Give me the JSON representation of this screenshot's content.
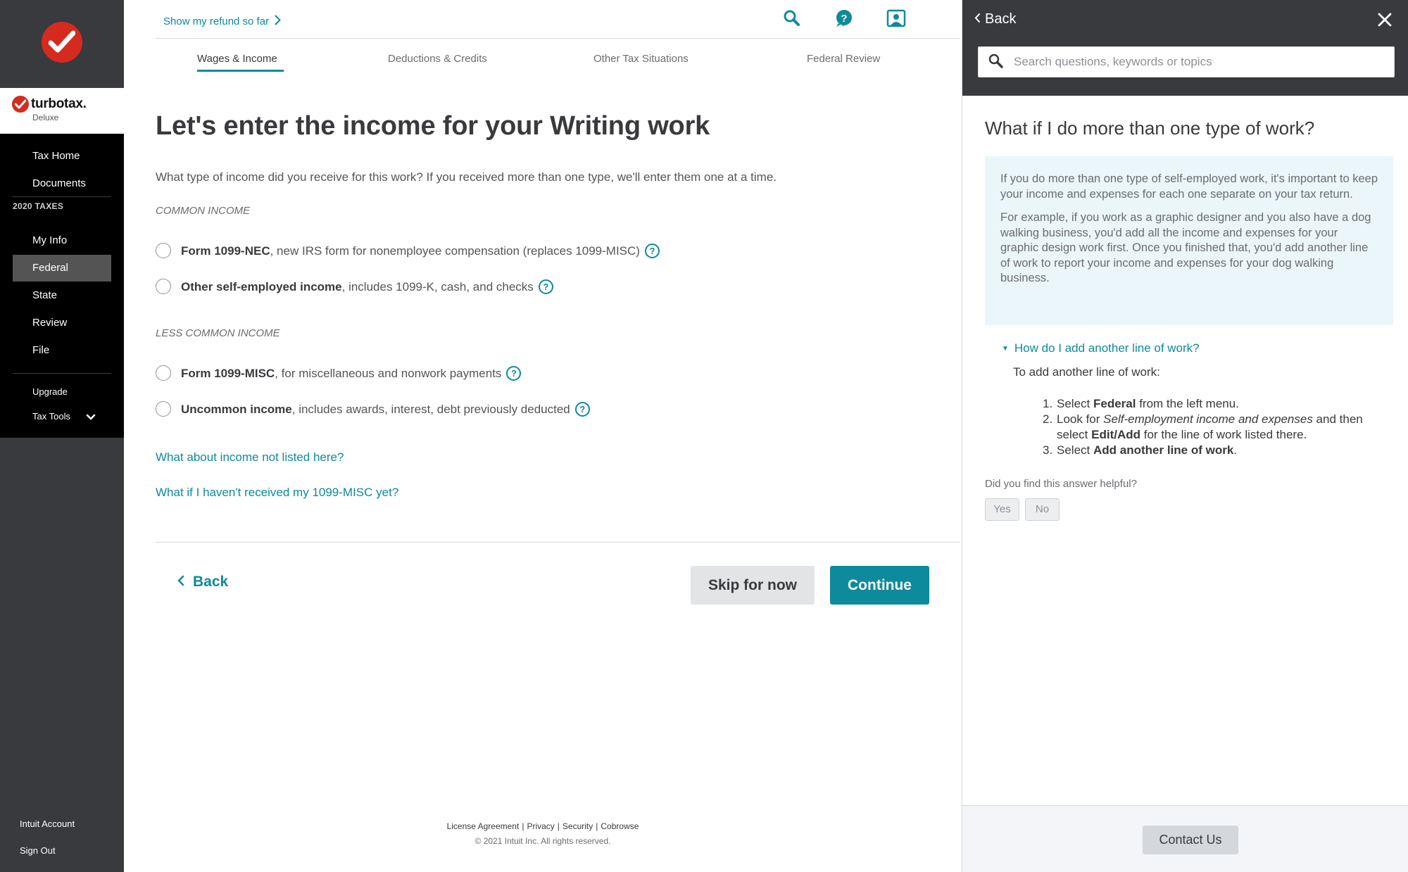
{
  "sidebar": {
    "brand_name": "turbotax.",
    "brand_edition": "Deluxe",
    "items": [
      {
        "label": "Tax Home"
      },
      {
        "label": "Documents"
      },
      {
        "label": "My Info"
      },
      {
        "label": "Federal"
      },
      {
        "label": "State"
      },
      {
        "label": "Review"
      },
      {
        "label": "File"
      },
      {
        "label": "Upgrade"
      },
      {
        "label": "Tax Tools"
      }
    ],
    "section_label": "2020 TAXES",
    "active_item": "Federal",
    "account_link": "Intuit Account",
    "signout_link": "Sign Out"
  },
  "header": {
    "refund_link": "Show my refund so far",
    "icons": [
      "search-icon",
      "help-icon",
      "profile-icon"
    ]
  },
  "steps": [
    {
      "label": "Wages & Income",
      "active": true
    },
    {
      "label": "Deductions & Credits",
      "active": false
    },
    {
      "label": "Other Tax Situations",
      "active": false
    },
    {
      "label": "Federal Review",
      "active": false
    }
  ],
  "main": {
    "title": "Let's enter the income for your Writing work",
    "intro": "What type of income did you receive for this work? If you received more than one type, we'll enter them one at a time.",
    "common_label": "COMMON INCOME",
    "less_common_label": "LESS COMMON INCOME",
    "options": [
      {
        "bold": "Form 1099-NEC",
        "rest": ", new IRS form for nonemployee compensation (replaces 1099-MISC)"
      },
      {
        "bold": "Other self-employed income",
        "rest": ", includes 1099-K, cash, and checks"
      },
      {
        "bold": "Form 1099-MISC",
        "rest": ", for miscellaneous and nonwork payments"
      },
      {
        "bold": "Uncommon income",
        "rest": ", includes awards, interest, debt previously deducted"
      }
    ],
    "help_glyph": "?",
    "link_not_listed": "What about income not listed here?",
    "link_not_received": "What if I haven't received my 1099-MISC yet?",
    "back_label": "Back",
    "skip_label": "Skip for now",
    "continue_label": "Continue"
  },
  "footer": {
    "links": [
      "License Agreement",
      "Privacy",
      "Security",
      "Cobrowse"
    ],
    "copyright": "© 2021 Intuit Inc. All rights reserved."
  },
  "help_panel": {
    "back_label": "Back",
    "search_placeholder": "Search questions, keywords or topics",
    "title": "What if I do more than one type of work?",
    "para1": "If you do more than one type of self-employed work, it's important to keep your income and expenses for each one separate on your tax return.",
    "para2": "For example, if you work as a graphic designer and you also have a dog walking business, you'd add all the income and expenses for your graphic design work first. Once you finished that, you'd add another line of work to report your income and expenses for your dog walking business.",
    "expander_label": "How do I add another line of work?",
    "expander_intro": "To add another line of work:",
    "step1_pre": "Select ",
    "step1_bold": "Federal",
    "step1_post": " from the left menu.",
    "step2_pre": "Look for ",
    "step2_italic": "Self-employment income and expenses",
    "step2_mid": " and then select ",
    "step2_bold": "Edit/Add",
    "step2_post": " for the line of work listed there.",
    "step3_pre": "Select ",
    "step3_bold": "Add another line of work",
    "step3_post": ".",
    "helpful_question": "Did you find this answer helpful?",
    "yes_label": "Yes",
    "no_label": "No",
    "contact_label": "Contact Us"
  },
  "colors": {
    "accent": "#0d8a9c",
    "sidebar_bg": "#393a3d",
    "nav_bg": "#000000",
    "brand_red": "#d52b1e",
    "help_box_bg": "#eaf6fa"
  }
}
